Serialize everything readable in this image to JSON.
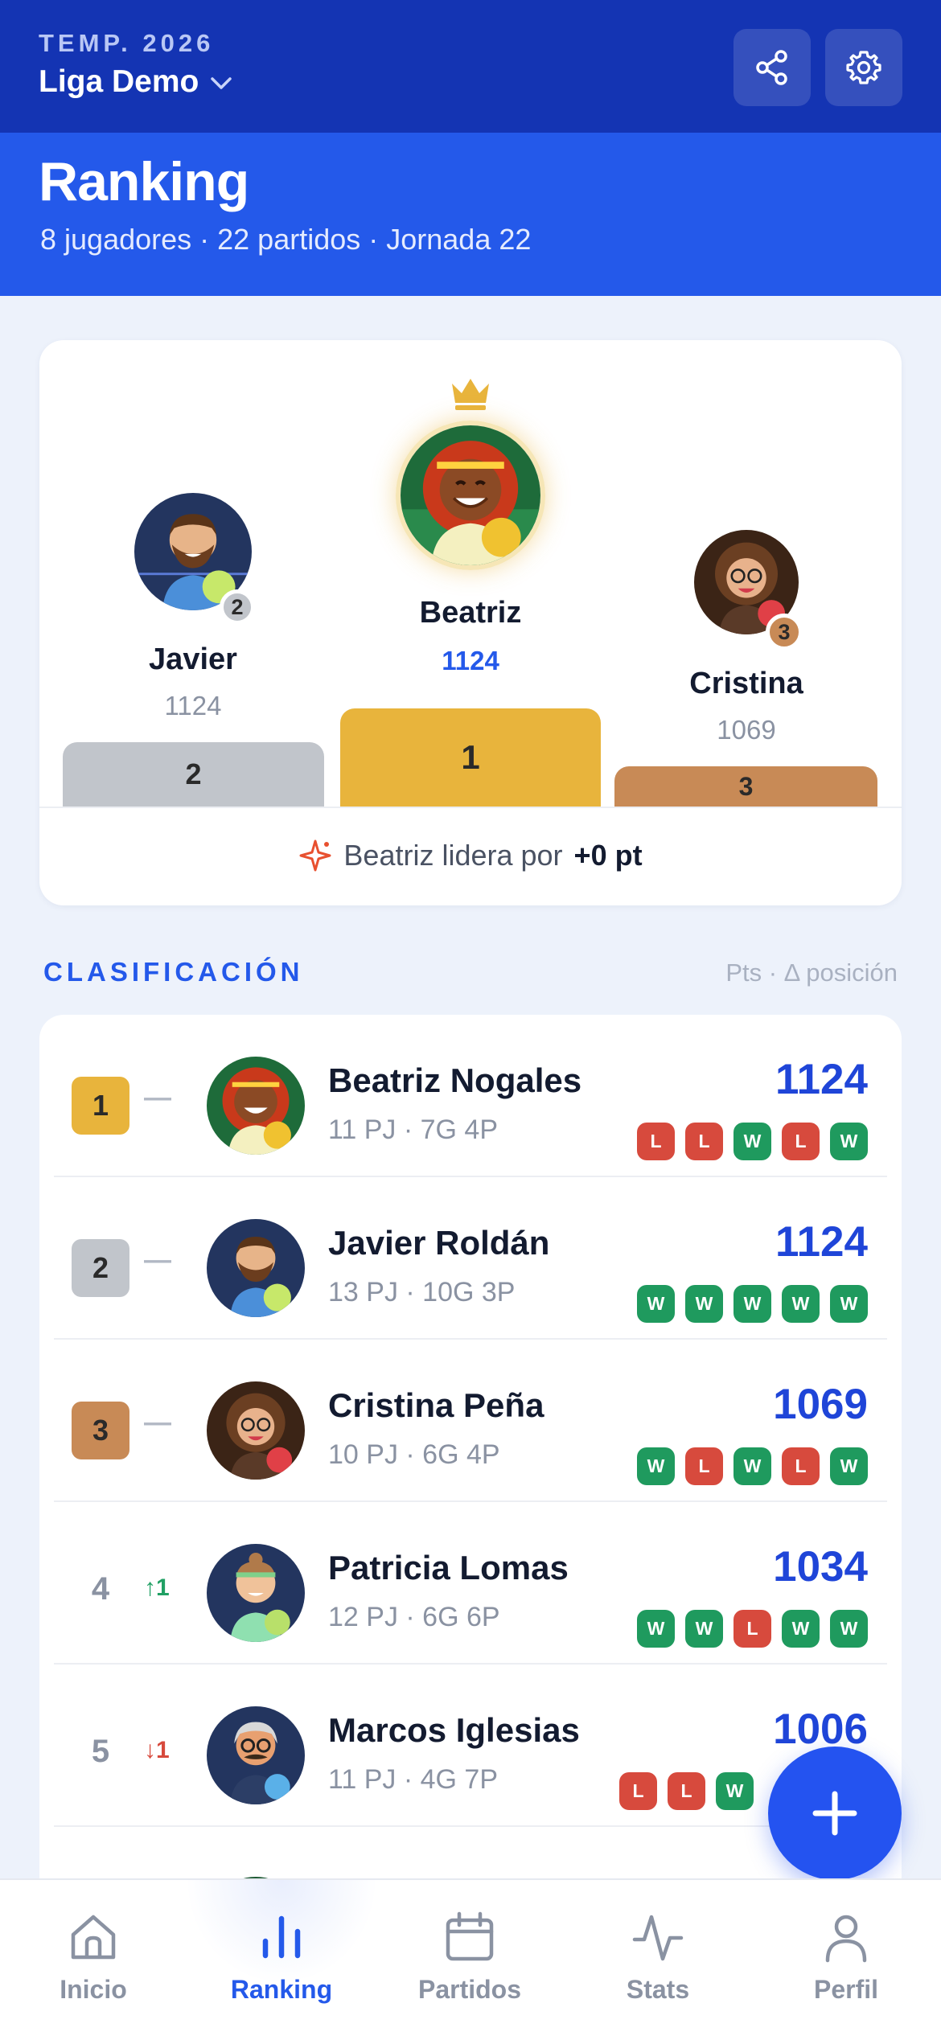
{
  "header": {
    "season": "TEMP. 2026",
    "league": "Liga Demo",
    "share_icon": "share-icon",
    "settings_icon": "gear-icon"
  },
  "hero": {
    "title": "Ranking",
    "subtitle": "8 jugadores · 22 partidos · Jornada 22"
  },
  "podium": {
    "first": {
      "name": "Beatriz",
      "pts": "1124",
      "place": "1"
    },
    "second": {
      "name": "Javier",
      "pts": "1124",
      "place": "2"
    },
    "third": {
      "name": "Cristina",
      "pts": "1069",
      "place": "3"
    },
    "lead_text": "Beatriz lidera por",
    "lead_value": "+0 pt"
  },
  "section": {
    "title": "CLASIFICACIÓN",
    "right": "Pts · Δ posición"
  },
  "standings": [
    {
      "rank": "1",
      "delta": "—",
      "name": "Beatriz Nogales",
      "meta": "11 PJ · 7G 4P",
      "pts": "1124",
      "form": [
        "L",
        "L",
        "W",
        "L",
        "W"
      ]
    },
    {
      "rank": "2",
      "delta": "—",
      "name": "Javier Roldán",
      "meta": "13 PJ · 10G 3P",
      "pts": "1124",
      "form": [
        "W",
        "W",
        "W",
        "W",
        "W"
      ]
    },
    {
      "rank": "3",
      "delta": "—",
      "name": "Cristina Peña",
      "meta": "10 PJ · 6G 4P",
      "pts": "1069",
      "form": [
        "W",
        "L",
        "W",
        "L",
        "W"
      ]
    },
    {
      "rank": "4",
      "delta": "↑1",
      "name": "Patricia Lomas",
      "meta": "12 PJ · 6G 6P",
      "pts": "1034",
      "form": [
        "W",
        "W",
        "L",
        "W",
        "W"
      ]
    },
    {
      "rank": "5",
      "delta": "↓1",
      "name": "Marcos Iglesias",
      "meta": "11 PJ · 4G 7P",
      "pts": "1006",
      "form": [
        "L",
        "L",
        "W"
      ]
    }
  ],
  "nav": {
    "items": [
      {
        "label": "Inicio",
        "icon": "home-icon"
      },
      {
        "label": "Ranking",
        "icon": "bar-chart-icon"
      },
      {
        "label": "Partidos",
        "icon": "calendar-icon"
      },
      {
        "label": "Stats",
        "icon": "pulse-icon"
      },
      {
        "label": "Perfil",
        "icon": "user-icon"
      }
    ],
    "active": "Ranking"
  },
  "colors": {
    "header": "#1434b3",
    "accent": "#2459ea",
    "gold": "#e8b43c",
    "silver": "#c1c5cb",
    "bronze": "#c88a56",
    "win": "#1f9a5e",
    "loss": "#d74a3d"
  }
}
